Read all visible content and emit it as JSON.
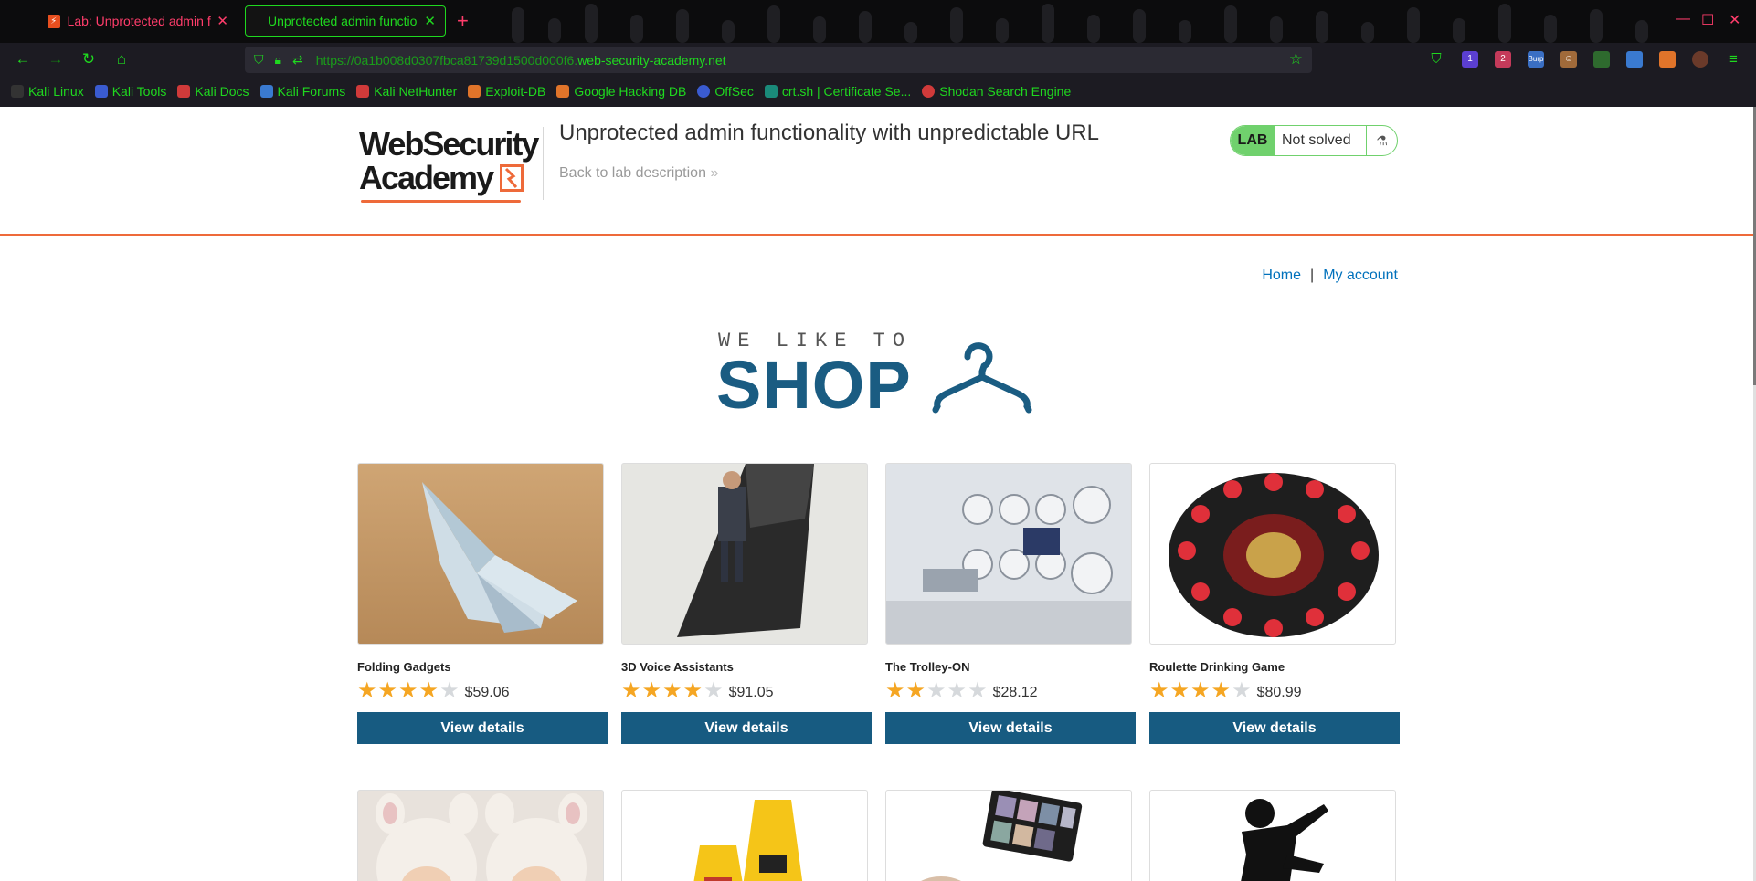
{
  "browser": {
    "tabs": [
      {
        "label": "Lab: Unprotected admin fu",
        "active": false
      },
      {
        "label": "Unprotected admin functio",
        "active": true
      }
    ],
    "url_prefix": "https://0a1b008d0307fbca81739d1500d000f6.",
    "url_domain": "web-security-academy.net",
    "bookmarks": [
      "Kali Linux",
      "Kali Tools",
      "Kali Docs",
      "Kali Forums",
      "Kali NetHunter",
      "Exploit-DB",
      "Google Hacking DB",
      "OffSec",
      "crt.sh | Certificate Se...",
      "Shodan Search Engine"
    ],
    "ext_badges": [
      "1",
      "2",
      "Burp"
    ]
  },
  "header": {
    "logo_line1": "WebSecurity",
    "logo_line2": "Academy",
    "lab_title": "Unprotected admin functionality with unpredictable URL",
    "back_link": "Back to lab description",
    "lab_badge": "LAB",
    "lab_state": "Not solved"
  },
  "nav": {
    "home": "Home",
    "separator": "|",
    "my_account": "My account"
  },
  "hero": {
    "top": "WE LIKE TO",
    "main": "SHOP"
  },
  "products": [
    {
      "name": "Folding Gadgets",
      "rating": 4,
      "price": "$59.06",
      "button": "View details"
    },
    {
      "name": "3D Voice Assistants",
      "rating": 4,
      "price": "$91.05",
      "button": "View details"
    },
    {
      "name": "The Trolley-ON",
      "rating": 2,
      "price": "$28.12",
      "button": "View details"
    },
    {
      "name": "Roulette Drinking Game",
      "rating": 4,
      "price": "$80.99",
      "button": "View details"
    }
  ],
  "colors": {
    "accent_orange": "#ee6a3a",
    "button_blue": "#175b81",
    "link_blue": "#0071bc",
    "lab_green": "#70d16d",
    "star": "#f5a623"
  }
}
